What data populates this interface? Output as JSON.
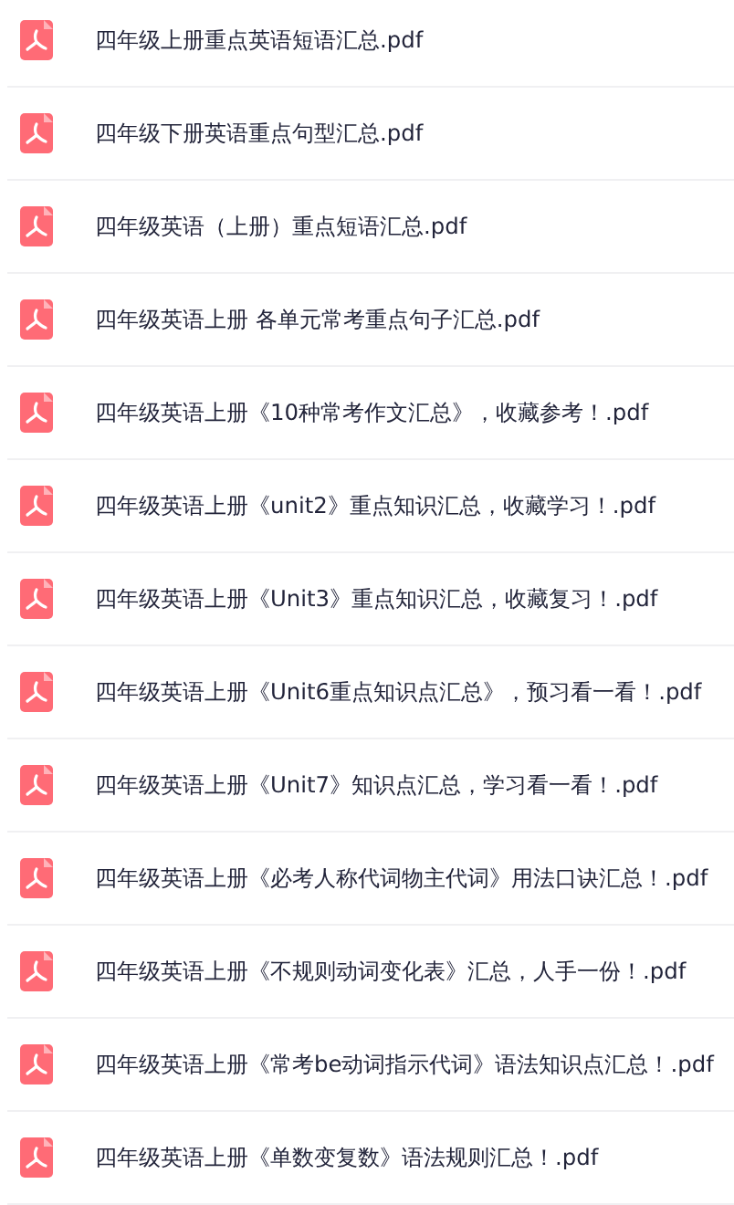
{
  "files": [
    {
      "name": "四年级上册重点英语短语汇总.pdf",
      "kind": "pdf"
    },
    {
      "name": "四年级下册英语重点句型汇总.pdf",
      "kind": "pdf"
    },
    {
      "name": "四年级英语（上册）重点短语汇总.pdf",
      "kind": "pdf"
    },
    {
      "name": "四年级英语上册 各单元常考重点句子汇总.pdf",
      "kind": "pdf"
    },
    {
      "name": "四年级英语上册《10种常考作文汇总》，收藏参考！.pdf",
      "kind": "pdf"
    },
    {
      "name": "四年级英语上册《unit2》重点知识汇总，收藏学习！.pdf",
      "kind": "pdf"
    },
    {
      "name": "四年级英语上册《Unit3》重点知识汇总，收藏复习！.pdf",
      "kind": "pdf"
    },
    {
      "name": "四年级英语上册《Unit6重点知识点汇总》，预习看一看！.pdf",
      "kind": "pdf"
    },
    {
      "name": "四年级英语上册《Unit7》知识点汇总，学习看一看！.pdf",
      "kind": "pdf"
    },
    {
      "name": "四年级英语上册《必考人称代词物主代词》用法口诀汇总！.pdf",
      "kind": "pdf"
    },
    {
      "name": "四年级英语上册《不规则动词变化表》汇总，人手一份！.pdf",
      "kind": "pdf"
    },
    {
      "name": "四年级英语上册《常考be动词指示代词》语法知识点汇总！.pdf",
      "kind": "pdf"
    },
    {
      "name": "四年级英语上册《单数变复数》语法规则汇总！.pdf",
      "kind": "pdf"
    }
  ]
}
